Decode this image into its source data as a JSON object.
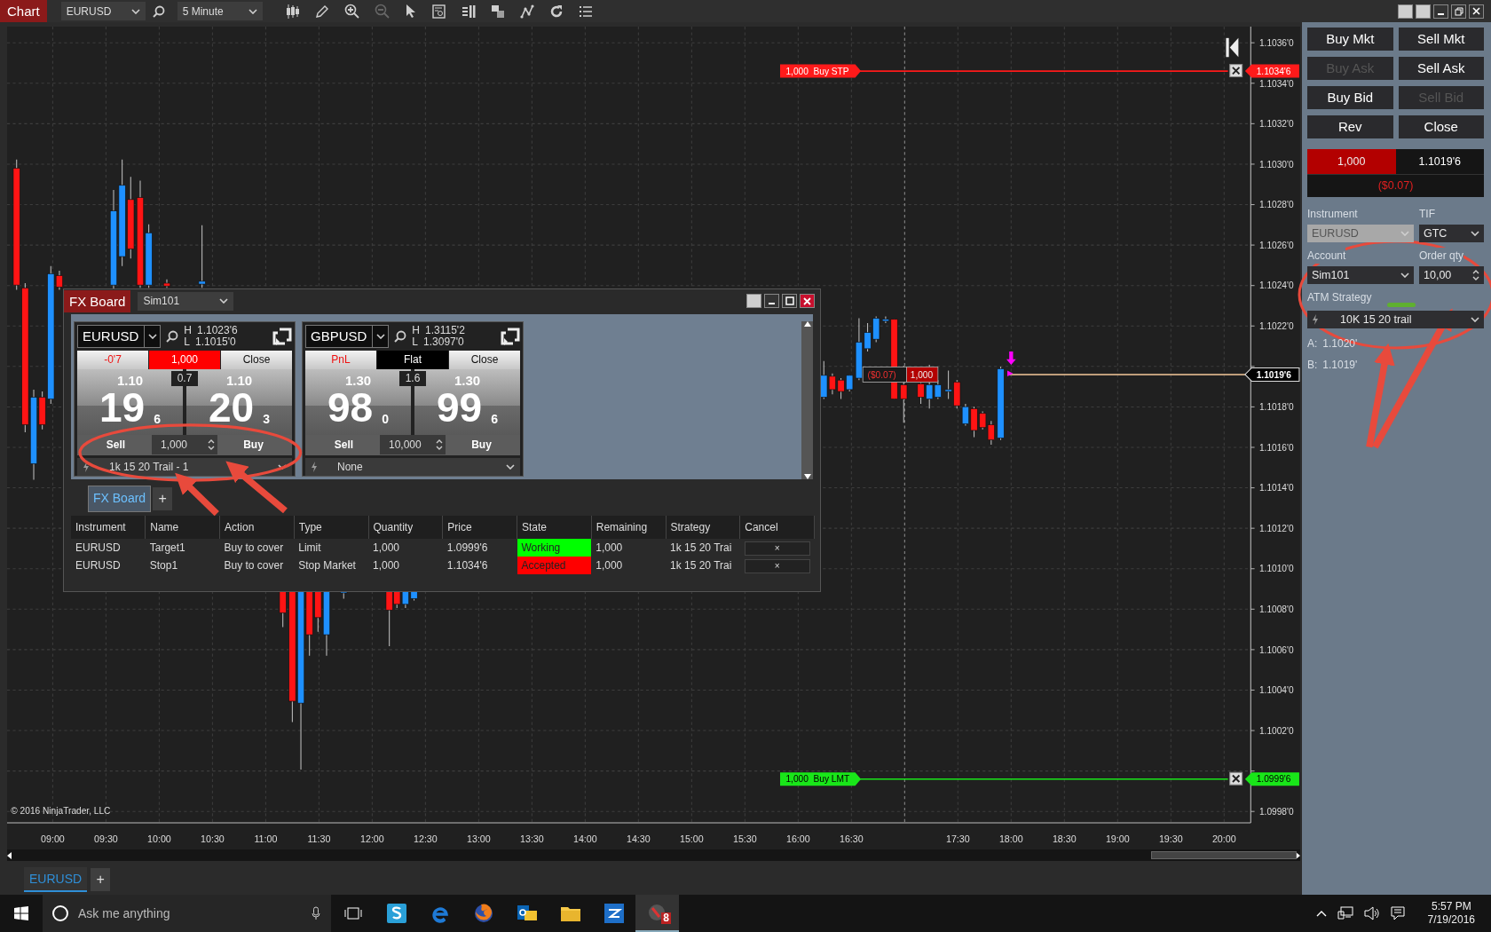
{
  "toolbar": {
    "title": "Chart",
    "instrument": "EURUSD",
    "interval": "5 Minute"
  },
  "chart": {
    "price_labels": [
      "1.1036'0",
      "1.1034'0",
      "1.1032'0",
      "1.1030'0",
      "1.1028'0",
      "1.1026'0",
      "1.1024'0",
      "1.1022'0",
      "1.1018'0",
      "1.1016'0",
      "1.1014'0",
      "1.1012'0",
      "1.1010'0",
      "1.1008'0",
      "1.1006'0",
      "1.1004'0",
      "1.1002'0",
      "1.0998'0"
    ],
    "time_labels": [
      "09:00",
      "09:30",
      "10:00",
      "10:30",
      "11:00",
      "11:30",
      "12:00",
      "12:30",
      "13:00",
      "13:30",
      "14:00",
      "14:30",
      "15:00",
      "15:30",
      "16:00",
      "16:30",
      "17:30",
      "18:00",
      "18:30",
      "19:00",
      "19:30",
      "20:00"
    ],
    "order_lines": [
      {
        "kind": "stop",
        "quantity": "1,000",
        "label": "Buy STP",
        "price": "1.1034'6"
      },
      {
        "kind": "limit",
        "quantity": "1,000",
        "label": "Buy LMT",
        "price": "1.0999'6"
      }
    ],
    "last_price": "1.1019'6",
    "position": {
      "pnl": "($0.07)",
      "quantity": "1,000"
    },
    "copyright": "© 2016 NinjaTrader, LLC"
  },
  "fx_board": {
    "title": "FX Board",
    "account": "Sim101",
    "tiles": [
      {
        "instrument": "EURUSD",
        "high_label": "H",
        "high": "1.1023'6",
        "low_label": "L",
        "low": "1.1015'0",
        "position": {
          "kind": "short",
          "pnl": "-0'7",
          "quantity": "1,000",
          "close": "Close"
        },
        "bid": {
          "figure": "1.10",
          "pips": "19",
          "fraction": "6"
        },
        "spread": "0.7",
        "ask": {
          "figure": "1.10",
          "pips": "20",
          "fraction": "3"
        },
        "sell": "Sell",
        "quantity": "1,000",
        "buy": "Buy",
        "atm": "1k 15 20 Trail - 1"
      },
      {
        "instrument": "GBPUSD",
        "high_label": "H",
        "high": "1.3115'2",
        "low_label": "L",
        "low": "1.3097'0",
        "position": {
          "kind": "flat",
          "pnl": "PnL",
          "quantity": "Flat",
          "close": "Close"
        },
        "bid": {
          "figure": "1.30",
          "pips": "98",
          "fraction": "0"
        },
        "spread": "1.6",
        "ask": {
          "figure": "1.30",
          "pips": "99",
          "fraction": "6"
        },
        "sell": "Sell",
        "quantity": "10,000",
        "buy": "Buy",
        "atm": "None"
      }
    ],
    "tabs": [
      {
        "label": "FX Board",
        "selected": true
      }
    ],
    "add_tab": "+",
    "orders": {
      "columns": [
        "Instrument",
        "Name",
        "Action",
        "Type",
        "Quantity",
        "Price",
        "State",
        "Remaining",
        "Strategy",
        "Cancel"
      ],
      "rows": [
        {
          "instrument": "EURUSD",
          "name": "Target1",
          "action": "Buy to cover",
          "type": "Limit",
          "quantity": "1,000",
          "price": "1.0999'6",
          "state": "Working",
          "color": "#00ff00",
          "remaining": "1,000",
          "strategy": "1k 15 20 Trai",
          "cancel": "×"
        },
        {
          "instrument": "EURUSD",
          "name": "Stop1",
          "action": "Buy to cover",
          "type": "Stop Market",
          "quantity": "1,000",
          "price": "1.1034'6",
          "state": "Accepted",
          "color": "#ff0000",
          "remaining": "1,000",
          "strategy": "1k 15 20 Trai",
          "cancel": "×"
        }
      ]
    }
  },
  "chart_tabs": [
    {
      "label": "EURUSD",
      "selected": true
    }
  ],
  "chart_add_tab": "+",
  "order_panel": {
    "buttons": [
      {
        "label": "Buy Mkt",
        "disabled": false
      },
      {
        "label": "Sell Mkt",
        "disabled": false
      },
      {
        "label": "Buy Ask",
        "disabled": true
      },
      {
        "label": "Sell Ask",
        "disabled": false
      },
      {
        "label": "Buy Bid",
        "disabled": false
      },
      {
        "label": "Sell Bid",
        "disabled": true
      },
      {
        "label": "Rev",
        "disabled": false
      },
      {
        "label": "Close",
        "disabled": false
      }
    ],
    "position": {
      "kind": "short",
      "quantity": "1,000",
      "price": "1.1019'6",
      "pnl": "($0.07)"
    },
    "instrument_label": "Instrument",
    "instrument": {
      "value": "EURUSD",
      "disabled": true
    },
    "tif_label": "TIF",
    "tif": "GTC",
    "account_label": "Account",
    "account": "Sim101",
    "quantity_label": "Order qty",
    "quantity": "10,00",
    "atm_label": "ATM Strategy",
    "atm_strategy": "10K 15 20 trail",
    "ask_label": "A:",
    "ask": "1.1020'",
    "bid_label": "B:",
    "bid": "1.1019'"
  },
  "taskbar": {
    "search_placeholder": "Ask me anything",
    "badge": "8",
    "time": "5:57 PM",
    "date": "7/19/2016"
  }
}
